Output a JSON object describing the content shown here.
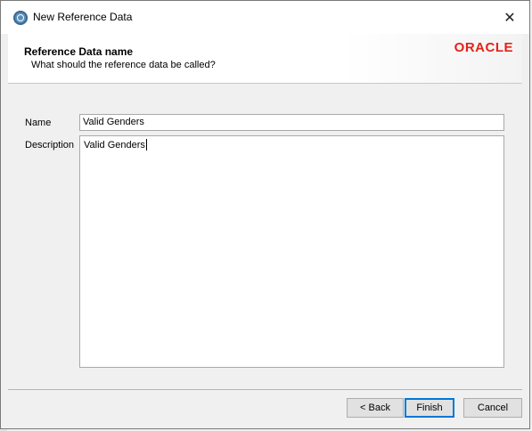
{
  "window": {
    "title": "New Reference Data",
    "close_glyph": "✕"
  },
  "header": {
    "title": "Reference Data name",
    "subtitle": "What should the reference data be called?",
    "logo": "ORACLE"
  },
  "form": {
    "name_label": "Name",
    "name_value": "Valid Genders",
    "description_label": "Description",
    "description_value": "Valid Genders"
  },
  "buttons": {
    "back": "< Back",
    "finish": "Finish",
    "cancel": "Cancel"
  },
  "colors": {
    "logo_red": "#e2231a",
    "default_button_border": "#0078d7"
  }
}
